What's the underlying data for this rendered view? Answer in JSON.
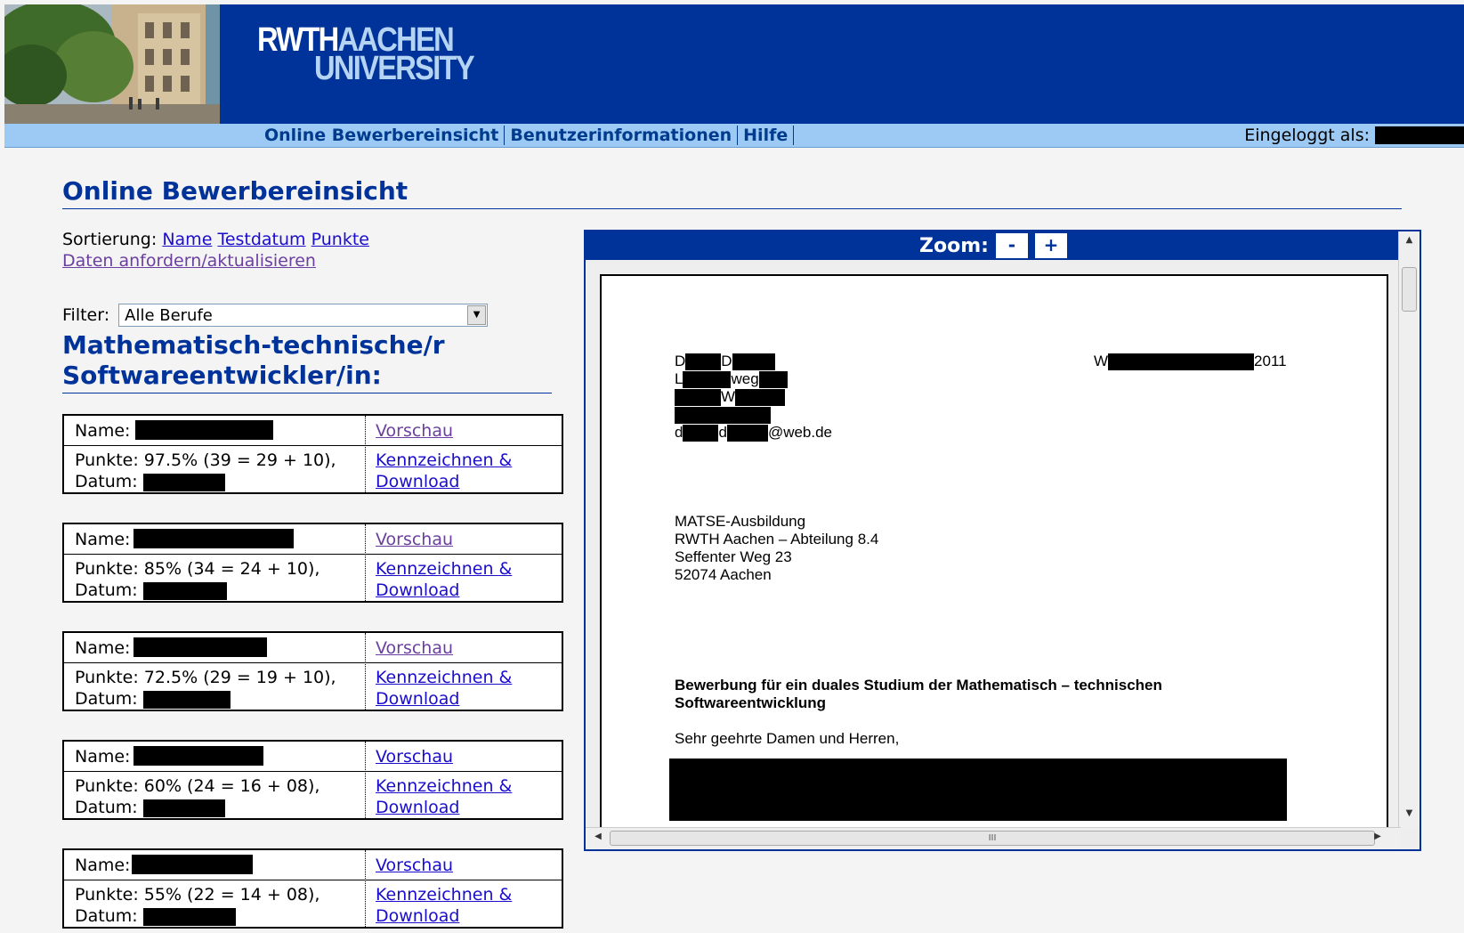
{
  "header": {
    "logo_part1": "RWTH",
    "logo_part2": "AACHEN",
    "logo_part3": "UNIVERSITY",
    "nav": [
      "Online Bewerbereinsicht",
      "Benutzerinformationen",
      "Hilfe"
    ],
    "login_label": "Eingeloggt als:"
  },
  "page": {
    "title": "Online Bewerbereinsicht",
    "sort_label": "Sortierung:",
    "sort_links": [
      "Name",
      "Testdatum",
      "Punkte"
    ],
    "refresh_link": "Daten anfordern/aktualisieren",
    "filter_label": "Filter:",
    "filter_value": "Alle Berufe",
    "section_title": "Mathematisch-technische/r Softwareentwickler/in:"
  },
  "card_labels": {
    "name": "Name:",
    "preview": "Vorschau",
    "date": "Datum:",
    "download_line1": "Kennzeichnen &",
    "download_line2": "Download"
  },
  "applicants": [
    {
      "points": "Punkte: 97.5% (39 = 29 + 10),"
    },
    {
      "points": "Punkte: 85% (34 = 24 + 10),"
    },
    {
      "points": "Punkte: 72.5% (29 = 19 + 10),"
    },
    {
      "points": "Punkte: 60% (24 = 16 + 08),"
    },
    {
      "points": "Punkte: 55% (22 = 14 + 08),"
    }
  ],
  "viewer": {
    "zoom_label": "Zoom:",
    "zoom_minus": "-",
    "zoom_plus": "+",
    "scroll_grip": "III"
  },
  "letter": {
    "sender_l1_a": "D",
    "sender_l1_b": "D",
    "sender_l2_a": "L",
    "sender_l2_b": "weg",
    "sender_l3": "W",
    "email_a": "d",
    "email_b": "d",
    "email_domain": "@web.de",
    "place_initial": "W",
    "year": "2011",
    "recipient": [
      "MATSE-Ausbildung",
      "RWTH Aachen – Abteilung 8.4",
      "Seffenter Weg 23",
      "52074 Aachen"
    ],
    "subject_line1": "Bewerbung für ein duales Studium der Mathematisch – technischen",
    "subject_line2": "Softwareentwicklung",
    "salutation": "Sehr geehrte Damen und Herren,"
  }
}
